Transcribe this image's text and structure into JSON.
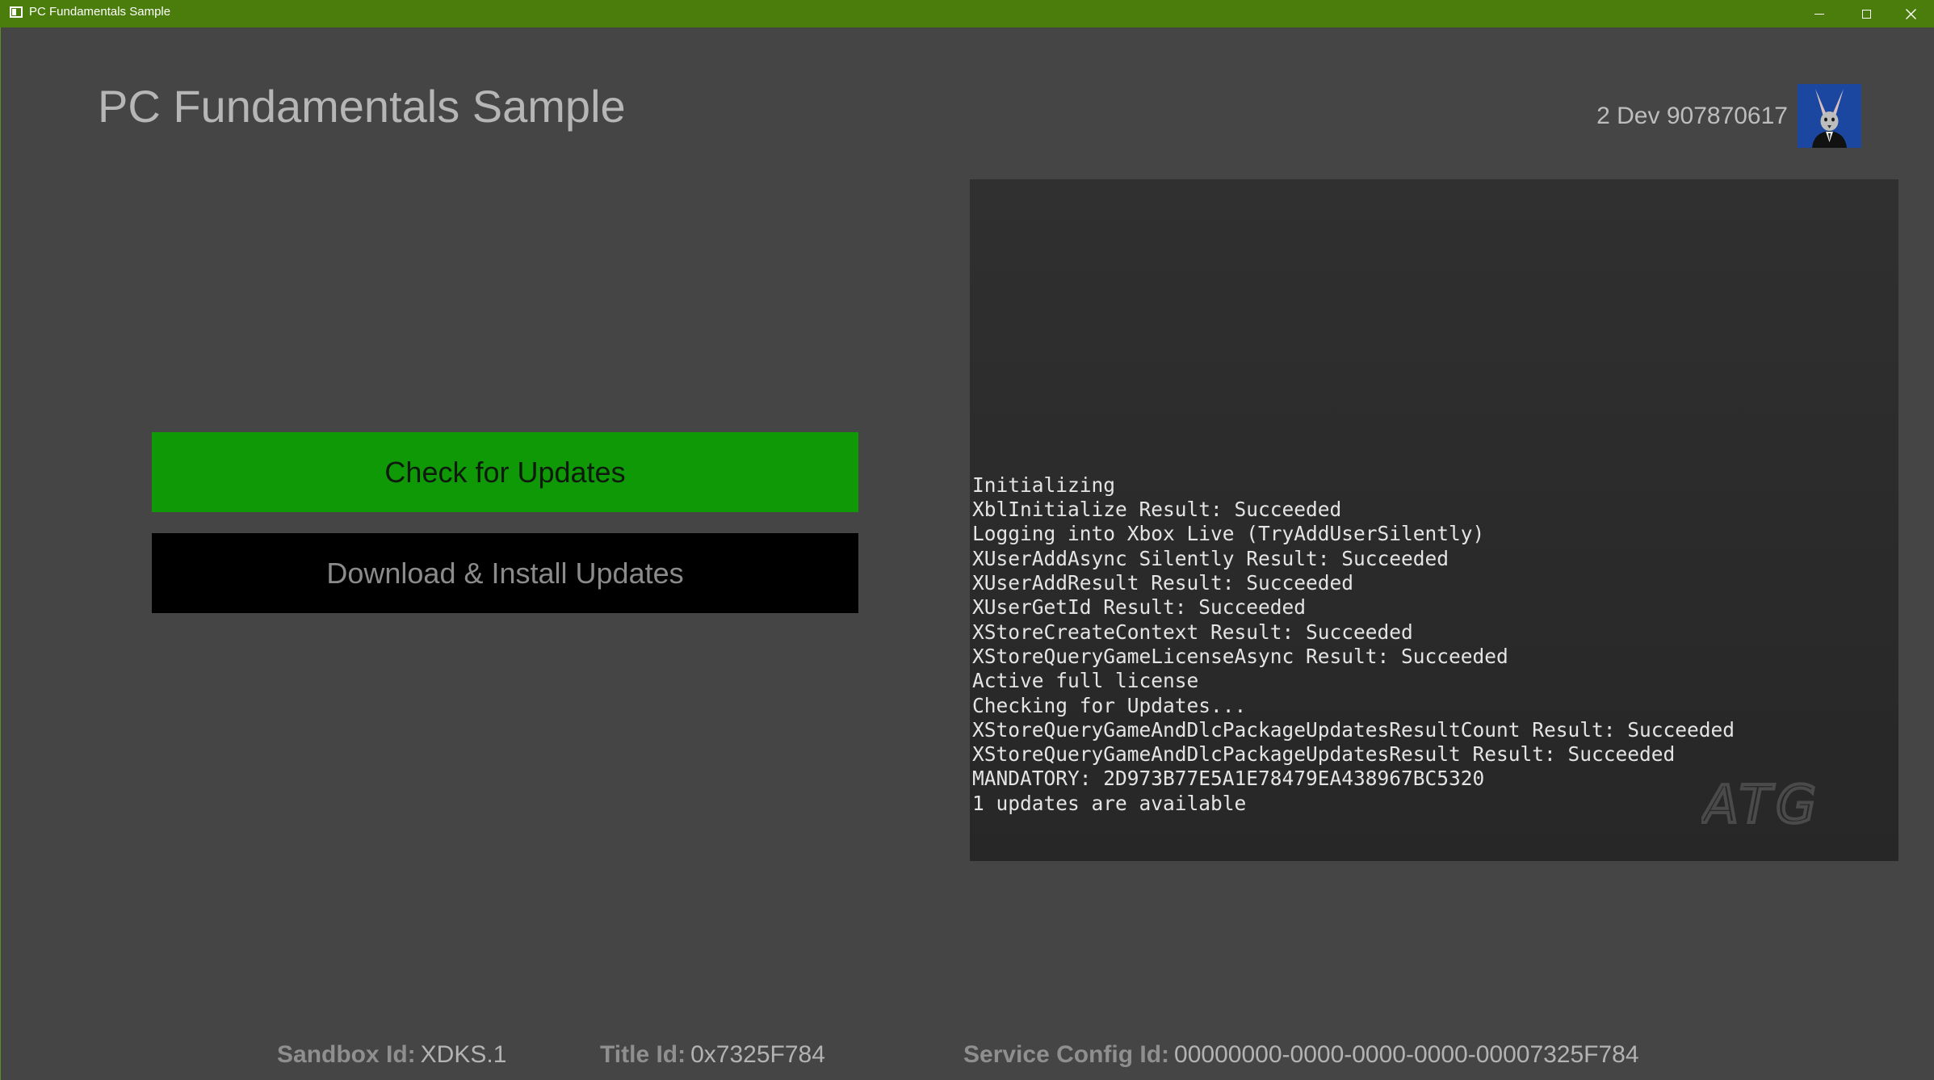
{
  "window": {
    "title": "PC Fundamentals Sample",
    "controls": {
      "minimize_icon": "minimize-icon",
      "maximize_icon": "maximize-icon",
      "close_icon": "close-icon"
    },
    "titlebar_color": "#4a7d0c"
  },
  "header": {
    "title": "PC Fundamentals Sample",
    "gamertag": "2 Dev 907870617",
    "avatar_icon": "user-avatar-icon"
  },
  "actions": {
    "check_updates_label": "Check for Updates",
    "download_install_label": "Download & Install Updates",
    "check_color": "#0f9907",
    "download_color": "#000000"
  },
  "log": {
    "lines": [
      "Initializing",
      "XblInitialize Result: Succeeded",
      "Logging into Xbox Live (TryAddUserSilently)",
      "XUserAddAsync Silently Result: Succeeded",
      "XUserAddResult Result: Succeeded",
      "XUserGetId Result: Succeeded",
      "XStoreCreateContext Result: Succeeded",
      "XStoreQueryGameLicenseAsync Result: Succeeded",
      "Active full license",
      "Checking for Updates...",
      "XStoreQueryGameAndDlcPackageUpdatesResultCount Result: Succeeded",
      "XStoreQueryGameAndDlcPackageUpdatesResult Result: Succeeded",
      "MANDATORY: 2D973B77E5A1E78479EA438967BC5320",
      "1 updates are available"
    ],
    "watermark_text": "ATG"
  },
  "footer": {
    "sandbox_label": "Sandbox Id:",
    "sandbox_value": "XDKS.1",
    "title_label": "Title Id:",
    "title_value": "0x7325F784",
    "scid_label": "Service Config Id:",
    "scid_value": "00000000-0000-0000-0000-00007325F784"
  }
}
